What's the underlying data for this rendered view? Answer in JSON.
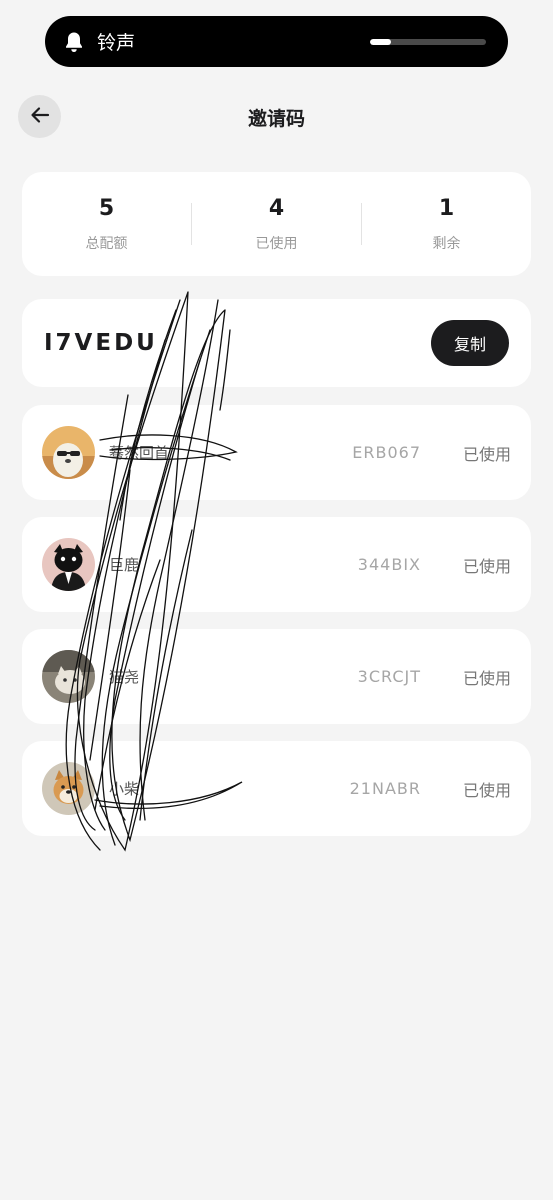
{
  "status_banner": {
    "label": "铃声",
    "icon": "bell-icon",
    "volume": 0.18
  },
  "header": {
    "title": "邀请码",
    "back_icon": "arrow-left-icon"
  },
  "stats": [
    {
      "value": "5",
      "label": "总配额"
    },
    {
      "value": "4",
      "label": "已使用"
    },
    {
      "value": "1",
      "label": "剩余"
    }
  ],
  "invite_code": {
    "code": "I7VEDU",
    "copy_label": "复制"
  },
  "invites": [
    {
      "name": "蓦然回首",
      "code": "ERB067",
      "status": "已使用"
    },
    {
      "name": "巨鹿",
      "code": "344BIX",
      "status": "已使用"
    },
    {
      "name": "猫尧",
      "code": "3CRCJT",
      "status": "已使用"
    },
    {
      "name": "小柴",
      "code": "21NABR",
      "status": "已使用"
    }
  ]
}
